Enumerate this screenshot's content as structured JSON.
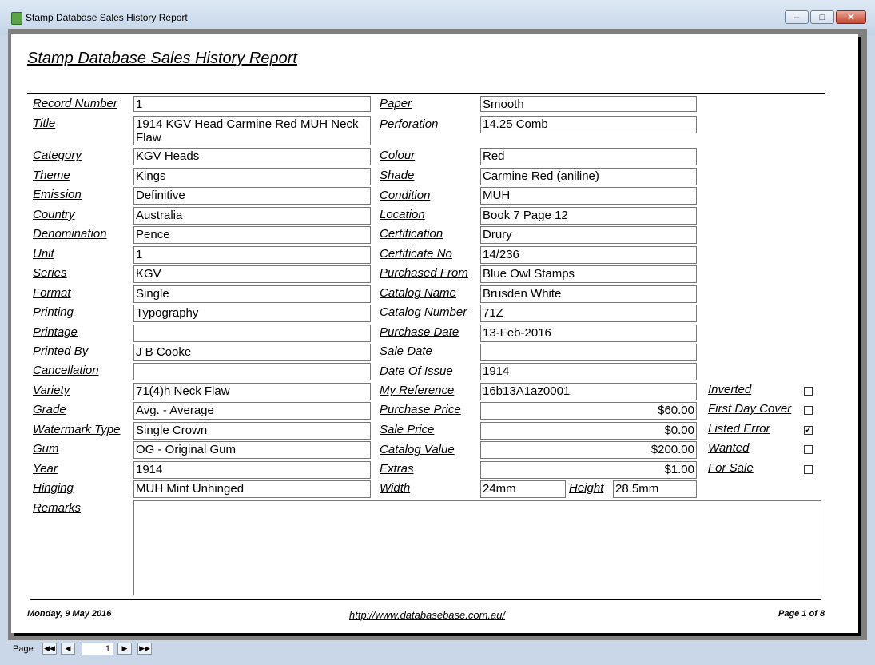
{
  "window": {
    "title": "Stamp Database Sales History Report"
  },
  "report": {
    "title": "Stamp Database Sales History Report",
    "left_fields": [
      {
        "label": "Record Number",
        "value": "1"
      },
      {
        "label": "Title",
        "value": "1914 KGV Head Carmine Red  MUH Neck Flaw"
      },
      {
        "label": "Category",
        "value": "KGV Heads"
      },
      {
        "label": "Theme",
        "value": "Kings"
      },
      {
        "label": "Emission",
        "value": "Definitive"
      },
      {
        "label": "Country",
        "value": "Australia"
      },
      {
        "label": "Denomination",
        "value": "Pence"
      },
      {
        "label": "Unit",
        "value": "1"
      },
      {
        "label": "Series",
        "value": "KGV"
      },
      {
        "label": "Format",
        "value": "Single"
      },
      {
        "label": "Printing",
        "value": "Typography"
      },
      {
        "label": "Printage",
        "value": ""
      },
      {
        "label": "Printed By",
        "value": "J B Cooke"
      },
      {
        "label": "Cancellation",
        "value": ""
      },
      {
        "label": "Variety",
        "value": "71(4)h Neck Flaw"
      },
      {
        "label": "Grade",
        "value": "Avg. - Average"
      },
      {
        "label": "Watermark Type",
        "value": "Single Crown"
      },
      {
        "label": "Gum",
        "value": "OG - Original Gum"
      },
      {
        "label": "Year",
        "value": "1914"
      },
      {
        "label": "Hinging",
        "value": "MUH  Mint Unhinged"
      }
    ],
    "right_fields": [
      {
        "label": "Paper",
        "value": "Smooth"
      },
      {
        "label": "Perforation",
        "value": "14.25 Comb"
      },
      {
        "label": "Colour",
        "value": "Red"
      },
      {
        "label": "Shade",
        "value": "Carmine Red (aniline)"
      },
      {
        "label": "Condition",
        "value": "MUH"
      },
      {
        "label": "Location",
        "value": "Book 7 Page 12"
      },
      {
        "label": "Certification",
        "value": "Drury"
      },
      {
        "label": "Certificate No",
        "value": "14/236"
      },
      {
        "label": "Purchased From",
        "value": "Blue Owl Stamps"
      },
      {
        "label": "Catalog Name",
        "value": "Brusden White"
      },
      {
        "label": "Catalog Number",
        "value": "71Z"
      },
      {
        "label": "Purchase Date",
        "value": "13-Feb-2016"
      },
      {
        "label": "Sale Date",
        "value": ""
      },
      {
        "label": "Date Of Issue",
        "value": "1914"
      },
      {
        "label": "My Reference",
        "value": "16b13A1az0001"
      },
      {
        "label": "Purchase Price",
        "value": "$60.00"
      },
      {
        "label": "Sale Price",
        "value": "$0.00"
      },
      {
        "label": "Catalog Value",
        "value": "$200.00"
      },
      {
        "label": "Extras",
        "value": "$1.00"
      }
    ],
    "width": {
      "label": "Width",
      "value": "24mm"
    },
    "height": {
      "label": "Height",
      "value": "28.5mm"
    },
    "checkboxes": [
      {
        "label": "Inverted",
        "checked": false
      },
      {
        "label": "First Day Cover",
        "checked": false
      },
      {
        "label": "Listed Error",
        "checked": true
      },
      {
        "label": "Wanted",
        "checked": false
      },
      {
        "label": "For Sale",
        "checked": false
      }
    ],
    "remarks": {
      "label": "Remarks",
      "value": ""
    },
    "footer": {
      "date": "Monday, 9 May 2016",
      "url": "http://www.databasebase.com.au/",
      "page": "Page 1 of 8"
    }
  },
  "statusbar": {
    "page_label": "Page:",
    "page_value": "1"
  }
}
